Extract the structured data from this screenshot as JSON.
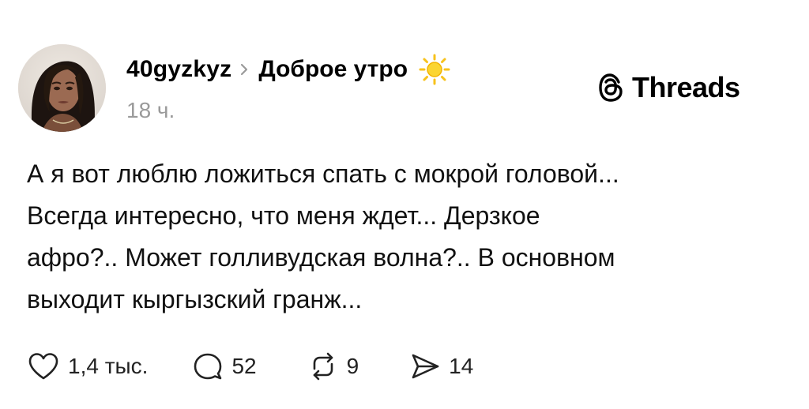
{
  "post": {
    "author": {
      "username": "40gyzkyz",
      "avatar_icon": "user-avatar-photo"
    },
    "topic": "Доброе утро",
    "topic_emoji": "sun-emoji-icon",
    "timestamp": "18 ч.",
    "brand": {
      "icon": "threads-logo-icon",
      "name": "Threads"
    },
    "text_lines": [
      "А я вот люблю ложиться спать с мокрой головой...",
      "Всегда интересно, что меня ждет... Дерзкое",
      "афро?.. Может голливудская волна?.. В основном",
      "выходит кыргызский гранж..."
    ],
    "actions": {
      "likes": "1,4 тыс.",
      "replies": "52",
      "reposts": "9",
      "shares": "14"
    },
    "colors": {
      "text": "#000000",
      "muted": "#9a9a9a",
      "sun": "#f7c21b"
    }
  }
}
